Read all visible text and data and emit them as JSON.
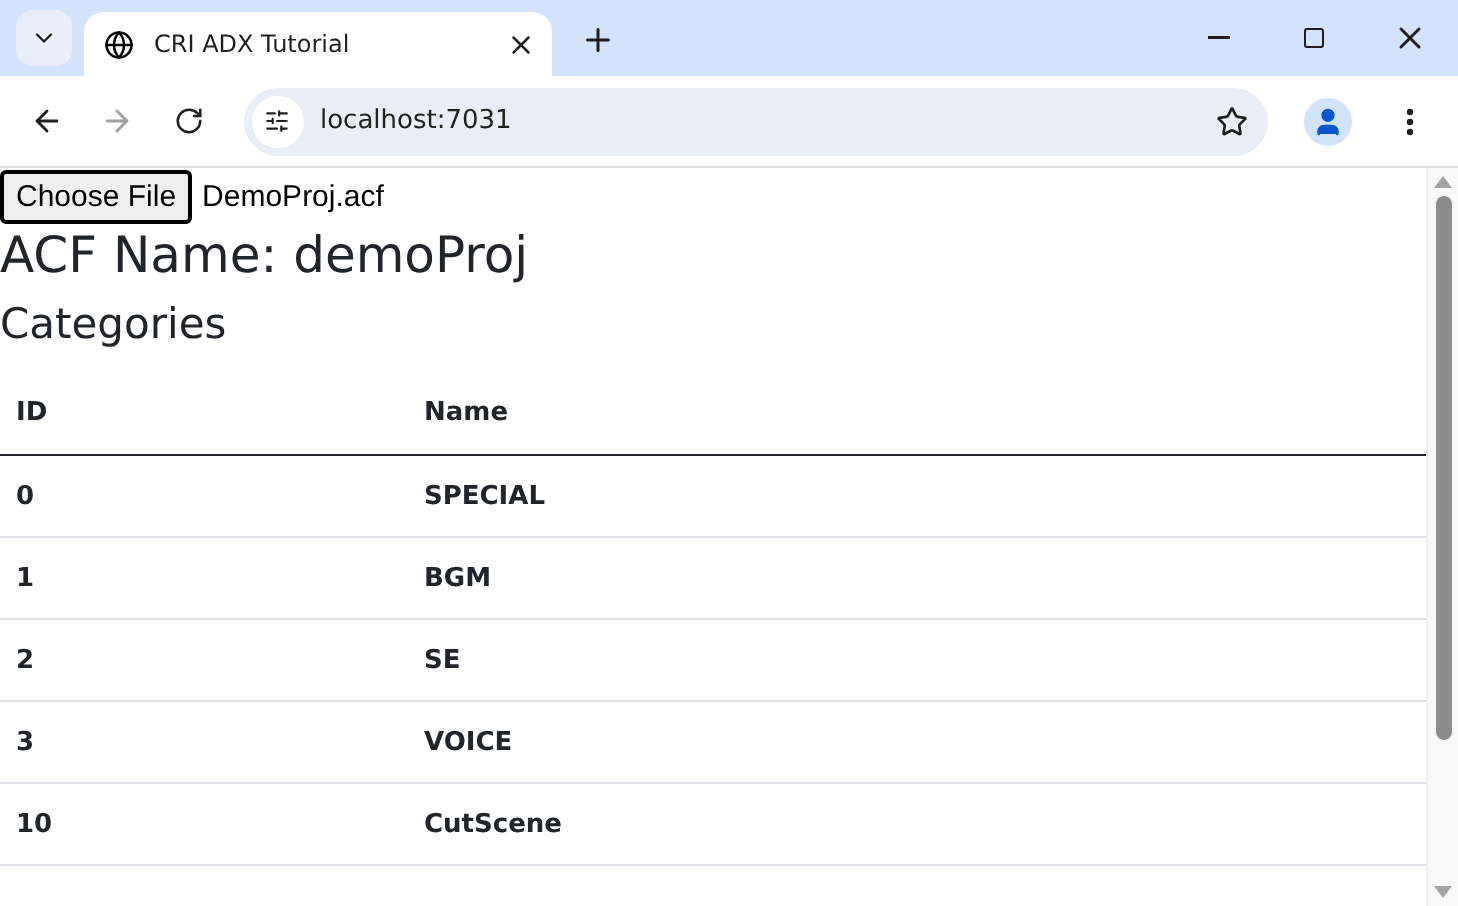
{
  "browser": {
    "tab_title": "CRI ADX Tutorial",
    "url": "localhost:7031"
  },
  "file_input": {
    "button": "Choose File",
    "file_name": "DemoProj.acf"
  },
  "heading": "ACF Name: demoProj",
  "subheading": "Categories",
  "table": {
    "columns": [
      "ID",
      "Name"
    ],
    "rows": [
      {
        "id": "0",
        "name": "SPECIAL"
      },
      {
        "id": "1",
        "name": "BGM"
      },
      {
        "id": "2",
        "name": "SE"
      },
      {
        "id": "3",
        "name": "VOICE"
      },
      {
        "id": "10",
        "name": "CutScene"
      }
    ]
  }
}
